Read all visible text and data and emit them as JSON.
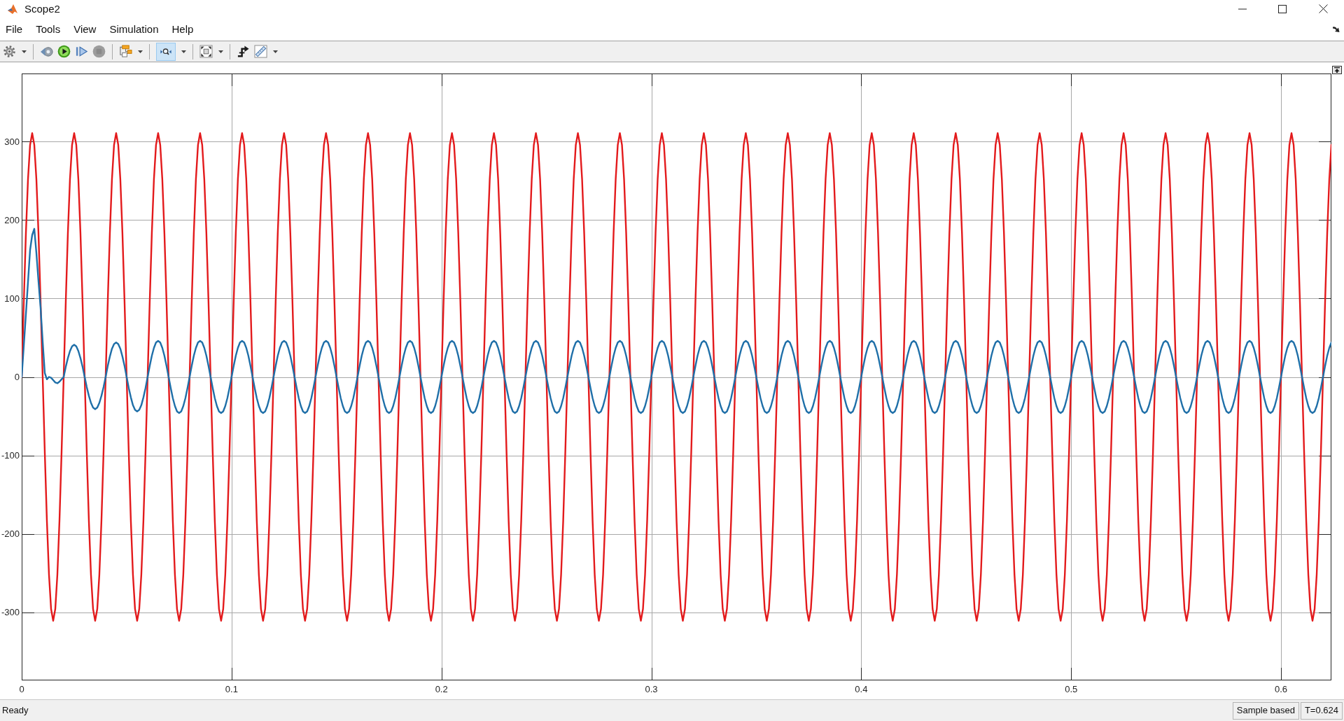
{
  "window": {
    "title": "Scope2"
  },
  "menu": [
    "File",
    "Tools",
    "View",
    "Simulation",
    "Help"
  ],
  "toolbar": [
    {
      "buttons": [
        {
          "kind": "settings",
          "dropdown": true,
          "on": false,
          "disabled": false
        }
      ]
    },
    {
      "buttons": [
        {
          "kind": "step_back",
          "dropdown": false,
          "on": false,
          "disabled": false
        },
        {
          "kind": "run",
          "dropdown": false,
          "on": false,
          "disabled": false
        },
        {
          "kind": "step_forward",
          "dropdown": false,
          "on": false,
          "disabled": false
        },
        {
          "kind": "stop",
          "dropdown": false,
          "on": false,
          "disabled": true
        }
      ]
    },
    {
      "buttons": [
        {
          "kind": "highlight",
          "dropdown": true,
          "on": false,
          "disabled": false
        }
      ]
    },
    {
      "buttons": [
        {
          "kind": "zoom",
          "dropdown": true,
          "on": true,
          "disabled": false
        }
      ]
    },
    {
      "buttons": [
        {
          "kind": "fit",
          "dropdown": true,
          "on": false,
          "disabled": false
        }
      ]
    },
    {
      "buttons": [
        {
          "kind": "trigger",
          "dropdown": false,
          "on": false,
          "disabled": false
        },
        {
          "kind": "measure",
          "dropdown": true,
          "on": false,
          "disabled": false
        }
      ]
    }
  ],
  "scope": {
    "chart_data": [
      {
        "type": "line",
        "xlim": [
          0,
          0.624
        ],
        "ylim": [
          -387,
          387
        ],
        "xticks": [
          0,
          0.1,
          0.2,
          0.3,
          0.4,
          0.5,
          0.6
        ],
        "yticks": [
          -300,
          -200,
          -100,
          0,
          100,
          200,
          300
        ],
        "grid": true,
        "x": [
          0.0,
          0.001,
          0.002,
          0.003,
          0.004,
          0.005,
          0.006,
          0.007,
          0.008,
          0.009,
          0.01,
          0.011,
          0.012,
          0.013,
          0.014,
          0.015,
          0.016,
          0.017,
          0.018,
          0.019,
          0.02,
          0.021,
          0.022,
          0.023,
          0.024,
          0.025,
          0.026,
          0.027,
          0.028,
          0.029,
          0.03,
          0.031,
          0.032,
          0.033,
          0.034,
          0.035,
          0.036,
          0.037,
          0.038,
          0.039,
          0.04,
          0.041,
          0.042,
          0.043,
          0.044,
          0.045,
          0.046,
          0.047,
          0.048,
          0.049,
          0.05,
          0.051,
          0.052,
          0.053,
          0.054,
          0.055,
          0.056,
          0.057,
          0.058,
          0.059,
          0.06,
          0.061,
          0.062,
          0.063,
          0.064,
          0.065,
          0.066,
          0.067,
          0.068,
          0.069,
          0.07,
          0.071,
          0.072,
          0.073,
          0.074,
          0.075,
          0.076,
          0.077,
          0.078,
          0.079,
          0.08,
          0.081,
          0.082,
          0.083,
          0.084,
          0.085,
          0.086,
          0.087,
          0.088,
          0.089,
          0.09,
          0.091,
          0.092,
          0.093,
          0.094,
          0.095,
          0.096,
          0.097,
          0.098,
          0.099,
          0.1,
          0.101,
          0.102,
          0.103,
          0.104,
          0.105,
          0.106,
          0.107,
          0.108,
          0.109,
          0.11,
          0.111,
          0.112,
          0.113,
          0.114,
          0.115,
          0.116,
          0.117,
          0.118,
          0.119,
          0.12,
          0.121,
          0.122,
          0.123,
          0.124,
          0.125,
          0.126,
          0.127,
          0.128,
          0.129,
          0.13,
          0.131,
          0.132,
          0.133,
          0.134,
          0.135,
          0.136,
          0.137,
          0.138,
          0.139,
          0.14,
          0.141,
          0.142,
          0.143,
          0.144,
          0.145,
          0.146,
          0.147,
          0.148,
          0.149,
          0.15,
          0.151,
          0.152,
          0.153,
          0.154,
          0.155,
          0.156,
          0.157,
          0.158,
          0.159,
          0.16,
          0.161,
          0.162,
          0.163,
          0.164,
          0.165,
          0.166,
          0.167,
          0.168,
          0.169,
          0.17,
          0.171,
          0.172,
          0.173,
          0.174,
          0.175,
          0.176,
          0.177,
          0.178,
          0.179,
          0.18,
          0.181,
          0.182,
          0.183,
          0.184,
          0.185,
          0.186,
          0.187,
          0.188,
          0.189,
          0.19,
          0.191,
          0.192,
          0.193,
          0.194,
          0.195,
          0.196,
          0.197,
          0.198,
          0.199,
          0.2,
          0.201,
          0.202,
          0.203,
          0.204,
          0.205,
          0.206,
          0.207,
          0.208,
          0.209,
          0.21,
          0.211,
          0.212,
          0.213,
          0.214,
          0.215,
          0.216,
          0.217,
          0.218,
          0.219,
          0.22,
          0.221,
          0.222,
          0.223,
          0.224,
          0.225,
          0.226,
          0.227,
          0.228,
          0.229,
          0.23,
          0.231,
          0.232,
          0.233,
          0.234,
          0.235,
          0.236,
          0.237,
          0.238,
          0.239,
          0.24,
          0.241,
          0.242,
          0.243,
          0.244,
          0.245,
          0.246,
          0.247,
          0.248,
          0.249,
          0.25,
          0.251,
          0.252,
          0.253,
          0.254,
          0.255,
          0.256,
          0.257,
          0.258,
          0.259,
          0.26,
          0.261,
          0.262,
          0.263,
          0.264,
          0.265,
          0.266,
          0.267,
          0.268,
          0.269,
          0.27,
          0.271,
          0.272,
          0.273,
          0.274,
          0.275,
          0.276,
          0.277,
          0.278,
          0.279,
          0.28,
          0.281,
          0.282,
          0.283,
          0.284,
          0.285,
          0.286,
          0.287,
          0.288,
          0.289,
          0.29,
          0.291,
          0.292,
          0.293,
          0.294,
          0.295,
          0.296,
          0.297,
          0.298,
          0.299,
          0.3,
          0.301,
          0.302,
          0.303,
          0.304,
          0.305,
          0.306,
          0.307,
          0.308,
          0.309,
          0.31,
          0.311,
          0.312,
          0.313,
          0.314,
          0.315,
          0.316,
          0.317,
          0.318,
          0.319,
          0.32,
          0.321,
          0.322,
          0.323,
          0.324,
          0.325,
          0.326,
          0.327,
          0.328,
          0.329,
          0.33,
          0.331,
          0.332,
          0.333,
          0.334,
          0.335,
          0.336,
          0.337,
          0.338,
          0.339,
          0.34,
          0.341,
          0.342,
          0.343,
          0.344,
          0.345,
          0.346,
          0.347,
          0.348,
          0.349,
          0.35,
          0.351,
          0.352,
          0.353,
          0.354,
          0.355,
          0.356,
          0.357,
          0.358,
          0.359,
          0.36,
          0.361,
          0.362,
          0.363,
          0.364,
          0.365,
          0.366,
          0.367,
          0.368,
          0.369,
          0.37,
          0.371,
          0.372,
          0.373,
          0.374,
          0.375,
          0.376,
          0.377,
          0.378,
          0.379,
          0.38,
          0.381,
          0.382,
          0.383,
          0.384,
          0.385,
          0.386,
          0.387,
          0.388,
          0.389,
          0.39,
          0.391,
          0.392,
          0.393,
          0.394,
          0.395,
          0.396,
          0.397,
          0.398,
          0.399,
          0.4,
          0.401,
          0.402,
          0.403,
          0.404,
          0.405,
          0.406,
          0.407,
          0.408,
          0.409,
          0.41,
          0.411,
          0.412,
          0.413,
          0.414,
          0.415,
          0.416,
          0.417,
          0.418,
          0.419,
          0.42,
          0.421,
          0.422,
          0.423,
          0.424,
          0.425,
          0.426,
          0.427,
          0.428,
          0.429,
          0.43,
          0.431,
          0.432,
          0.433,
          0.434,
          0.435,
          0.436,
          0.437,
          0.438,
          0.439,
          0.44,
          0.441,
          0.442,
          0.443,
          0.444,
          0.445,
          0.446,
          0.447,
          0.448,
          0.449,
          0.45,
          0.451,
          0.452,
          0.453,
          0.454,
          0.455,
          0.456,
          0.457,
          0.458,
          0.459,
          0.46,
          0.461,
          0.462,
          0.463,
          0.464,
          0.465,
          0.466,
          0.467,
          0.468,
          0.469,
          0.47,
          0.471,
          0.472,
          0.473,
          0.474,
          0.475,
          0.476,
          0.477,
          0.478,
          0.479,
          0.48,
          0.481,
          0.482,
          0.483,
          0.484,
          0.485,
          0.486,
          0.487,
          0.488,
          0.489,
          0.49,
          0.491,
          0.492,
          0.493,
          0.494,
          0.495,
          0.496,
          0.497,
          0.498,
          0.499,
          0.5,
          0.501,
          0.502,
          0.503,
          0.504,
          0.505,
          0.506,
          0.507,
          0.508,
          0.509,
          0.51,
          0.511,
          0.512,
          0.513,
          0.514,
          0.515,
          0.516,
          0.517,
          0.518,
          0.519,
          0.52,
          0.521,
          0.522,
          0.523,
          0.524,
          0.525,
          0.526,
          0.527,
          0.528,
          0.529,
          0.53,
          0.531,
          0.532,
          0.533,
          0.534,
          0.535,
          0.536,
          0.537,
          0.538,
          0.539,
          0.54,
          0.541,
          0.542,
          0.543,
          0.544,
          0.545,
          0.546,
          0.547,
          0.548,
          0.549,
          0.55,
          0.551,
          0.552,
          0.553,
          0.554,
          0.555,
          0.556,
          0.557,
          0.558,
          0.559,
          0.56,
          0.561,
          0.562,
          0.563,
          0.564,
          0.565,
          0.566,
          0.567,
          0.568,
          0.569,
          0.57,
          0.571,
          0.572,
          0.573,
          0.574,
          0.575,
          0.576,
          0.577,
          0.578,
          0.579,
          0.58,
          0.581,
          0.582,
          0.583,
          0.584,
          0.585,
          0.586,
          0.587,
          0.588,
          0.589,
          0.59,
          0.591,
          0.592,
          0.593,
          0.594,
          0.595,
          0.596,
          0.597,
          0.598,
          0.599,
          0.6,
          0.601,
          0.602,
          0.603,
          0.604,
          0.605,
          0.606,
          0.607,
          0.608,
          0.609,
          0.61,
          0.611,
          0.612,
          0.613,
          0.614,
          0.615,
          0.616,
          0.617,
          0.618,
          0.619,
          0.62,
          0.621,
          0.622,
          0.623,
          0.624
        ],
        "series": [
          {
            "color": "#e31a1c",
            "values": [
              0,
              96,
              183,
              252,
              296,
              311,
              296,
              252,
              183,
              96,
              0,
              -96,
              -183,
              -252,
              -296,
              -311,
              -296,
              -252,
              -183,
              -96,
              0,
              96,
              183,
              252,
              296,
              311,
              296,
              252,
              183,
              96,
              0,
              -96,
              -183,
              -252,
              -296,
              -311,
              -296,
              -252,
              -183,
              -96,
              0,
              96,
              183,
              252,
              296,
              311,
              296,
              252,
              183,
              96,
              0,
              -96,
              -183,
              -252,
              -296,
              -311,
              -296,
              -252,
              -183,
              -96,
              0,
              96,
              183,
              252,
              296,
              311,
              296,
              252,
              183,
              96,
              0,
              -96,
              -183,
              -252,
              -296,
              -311,
              -296,
              -252,
              -183,
              -96,
              0,
              96,
              183,
              252,
              296,
              311,
              296,
              252,
              183,
              96,
              0,
              -96,
              -183,
              -252,
              -296,
              -311,
              -296,
              -252,
              -183,
              -96,
              0,
              96,
              183,
              252,
              296,
              311,
              296,
              252,
              183,
              96,
              0,
              -96,
              -183,
              -252,
              -296,
              -311,
              -296,
              -252,
              -183,
              -96,
              0,
              96,
              183,
              252,
              296,
              311,
              296,
              252,
              183,
              96,
              0,
              -96,
              -183,
              -252,
              -296,
              -311,
              -296,
              -252,
              -183,
              -96,
              0,
              96,
              183,
              252,
              296,
              311,
              296,
              252,
              183,
              96,
              0,
              -96,
              -183,
              -252,
              -296,
              -311,
              -296,
              -252,
              -183,
              -96,
              0,
              96,
              183,
              252,
              296,
              311,
              296,
              252,
              183,
              96,
              0,
              -96,
              -183,
              -252,
              -296,
              -311,
              -296,
              -252,
              -183,
              -96,
              0,
              96,
              183,
              252,
              296,
              311,
              296,
              252,
              183,
              96,
              0,
              -96,
              -183,
              -252,
              -296,
              -311,
              -296,
              -252,
              -183,
              -96,
              0,
              96,
              183,
              252,
              296,
              311,
              296,
              252,
              183,
              96,
              0,
              -96,
              -183,
              -252,
              -296,
              -311,
              -296,
              -252,
              -183,
              -96,
              0,
              96,
              183,
              252,
              296,
              311,
              296,
              252,
              183,
              96,
              0,
              -96,
              -183,
              -252,
              -296,
              -311,
              -296,
              -252,
              -183,
              -96,
              0,
              96,
              183,
              252,
              296,
              311,
              296,
              252,
              183,
              96,
              0,
              -96,
              -183,
              -252,
              -296,
              -311,
              -296,
              -252,
              -183,
              -96,
              0,
              96,
              183,
              252,
              296,
              311,
              296,
              252,
              183,
              96,
              0,
              -96,
              -183,
              -252,
              -296,
              -311,
              -296,
              -252,
              -183,
              -96,
              0,
              96,
              183,
              252,
              296,
              311,
              296,
              252,
              183,
              96,
              0,
              -96,
              -183,
              -252,
              -296,
              -311,
              -296,
              -252,
              -183,
              -96,
              0,
              96,
              183,
              252,
              296,
              311,
              296,
              252,
              183,
              96,
              0,
              -96,
              -183,
              -252,
              -296,
              -311,
              -296,
              -252,
              -183,
              -96,
              0,
              96,
              183,
              252,
              296,
              311,
              296,
              252,
              183,
              96,
              0,
              -96,
              -183,
              -252,
              -296,
              -311,
              -296,
              -252,
              -183,
              -96,
              0,
              96,
              183,
              252,
              296,
              311,
              296,
              252,
              183,
              96,
              0,
              -96,
              -183,
              -252,
              -296,
              -311,
              -296,
              -252,
              -183,
              -96,
              0,
              96,
              183,
              252,
              296,
              311,
              296,
              252,
              183,
              96,
              0,
              -96,
              -183,
              -252,
              -296,
              -311,
              -296,
              -252,
              -183,
              -96,
              0,
              96,
              183,
              252,
              296,
              311,
              296,
              252,
              183,
              96,
              0,
              -96,
              -183,
              -252,
              -296,
              -311,
              -296,
              -252,
              -183,
              -96,
              0,
              96,
              183,
              252,
              296,
              311,
              296,
              252,
              183,
              96,
              0,
              -96,
              -183,
              -252,
              -296,
              -311,
              -296,
              -252,
              -183,
              -96,
              0,
              96,
              183,
              252,
              296,
              311,
              296,
              252,
              183,
              96,
              0,
              -96,
              -183,
              -252,
              -296,
              -311,
              -296,
              -252,
              -183,
              -96,
              0,
              96,
              183,
              252,
              296,
              311,
              296,
              252,
              183,
              96,
              0,
              -96,
              -183,
              -252,
              -296,
              -311,
              -296,
              -252,
              -183,
              -96,
              0,
              96,
              183,
              252,
              296,
              311,
              296,
              252,
              183,
              96,
              0,
              -96,
              -183,
              -252,
              -296,
              -311,
              -296,
              -252,
              -183,
              -96,
              0,
              96,
              183,
              252,
              296,
              311,
              296,
              252,
              183,
              96,
              0,
              -96,
              -183,
              -252,
              -296,
              -311,
              -296,
              -252,
              -183,
              -96,
              0,
              96,
              183,
              252,
              296,
              311,
              296,
              252,
              183,
              96,
              0,
              -96,
              -183,
              -252,
              -296,
              -311,
              -296,
              -252,
              -183,
              -96,
              0,
              96,
              183,
              252,
              296,
              311,
              296,
              252,
              183,
              96,
              0,
              -96,
              -183,
              -252,
              -296,
              -311,
              -296,
              -252,
              -183,
              -96,
              0,
              96,
              183,
              252,
              296,
              311,
              296,
              252,
              183,
              96,
              0,
              -96,
              -183,
              -252,
              -296,
              -311,
              -296,
              -252,
              -183,
              -96,
              0,
              96,
              183,
              252,
              296,
              311,
              296,
              252,
              183,
              96,
              0,
              -96,
              -183,
              -252,
              -296,
              -311,
              -296,
              -252,
              -183,
              -96,
              0,
              96,
              183,
              252,
              296,
              311,
              296,
              252,
              183,
              96,
              0,
              -96,
              -183,
              -252,
              -296,
              -311,
              -296,
              -252,
              -183,
              -96,
              0,
              96,
              183,
              252,
              296,
              311,
              296,
              252,
              183,
              96,
              0,
              -96,
              -183,
              -252,
              -296,
              -311,
              -296,
              -252,
              -183,
              -96,
              0,
              96,
              183,
              252,
              296
            ]
          },
          {
            "color": "#1f6fa8",
            "values": [
              0,
              40,
              80,
              121,
              162,
              181,
              189,
              158,
              122,
              88,
              45,
              5,
              -3,
              0,
              -1,
              -4,
              -7,
              -8,
              -6,
              -3,
              0,
              13,
              24,
              33,
              39,
              41,
              39,
              33,
              24,
              13,
              0,
              -13,
              -24,
              -33,
              -39,
              -41,
              -39,
              -33,
              -24,
              -13,
              0,
              14,
              26,
              36,
              42,
              44,
              42,
              36,
              26,
              14,
              0,
              -14,
              -26,
              -36,
              -42,
              -44,
              -42,
              -36,
              -26,
              -14,
              0,
              14,
              27,
              37,
              44,
              46,
              44,
              37,
              27,
              14,
              0,
              -14,
              -27,
              -37,
              -44,
              -46,
              -44,
              -37,
              -27,
              -14,
              0,
              14,
              27,
              37,
              44,
              46,
              44,
              37,
              27,
              14,
              0,
              -14,
              -27,
              -37,
              -44,
              -46,
              -44,
              -37,
              -27,
              -14,
              0,
              14,
              27,
              37,
              44,
              46,
              44,
              37,
              27,
              14,
              0,
              -14,
              -27,
              -37,
              -44,
              -46,
              -44,
              -37,
              -27,
              -14,
              0,
              14,
              27,
              37,
              44,
              46,
              44,
              37,
              27,
              14,
              0,
              -14,
              -27,
              -37,
              -44,
              -46,
              -44,
              -37,
              -27,
              -14,
              0,
              14,
              27,
              37,
              44,
              46,
              44,
              37,
              27,
              14,
              0,
              -14,
              -27,
              -37,
              -44,
              -46,
              -44,
              -37,
              -27,
              -14,
              0,
              14,
              27,
              37,
              44,
              46,
              44,
              37,
              27,
              14,
              0,
              -14,
              -27,
              -37,
              -44,
              -46,
              -44,
              -37,
              -27,
              -14,
              0,
              14,
              27,
              37,
              44,
              46,
              44,
              37,
              27,
              14,
              0,
              -14,
              -27,
              -37,
              -44,
              -46,
              -44,
              -37,
              -27,
              -14,
              0,
              14,
              27,
              37,
              44,
              46,
              44,
              37,
              27,
              14,
              0,
              -14,
              -27,
              -37,
              -44,
              -46,
              -44,
              -37,
              -27,
              -14,
              0,
              14,
              27,
              37,
              44,
              46,
              44,
              37,
              27,
              14,
              0,
              -14,
              -27,
              -37,
              -44,
              -46,
              -44,
              -37,
              -27,
              -14,
              0,
              14,
              27,
              37,
              44,
              46,
              44,
              37,
              27,
              14,
              0,
              -14,
              -27,
              -37,
              -44,
              -46,
              -44,
              -37,
              -27,
              -14,
              0,
              14,
              27,
              37,
              44,
              46,
              44,
              37,
              27,
              14,
              0,
              -14,
              -27,
              -37,
              -44,
              -46,
              -44,
              -37,
              -27,
              -14,
              0,
              14,
              27,
              37,
              44,
              46,
              44,
              37,
              27,
              14,
              0,
              -14,
              -27,
              -37,
              -44,
              -46,
              -44,
              -37,
              -27,
              -14,
              0,
              14,
              27,
              37,
              44,
              46,
              44,
              37,
              27,
              14,
              0,
              -14,
              -27,
              -37,
              -44,
              -46,
              -44,
              -37,
              -27,
              -14,
              0,
              14,
              27,
              37,
              44,
              46,
              44,
              37,
              27,
              14,
              0,
              -14,
              -27,
              -37,
              -44,
              -46,
              -44,
              -37,
              -27,
              -14,
              0,
              14,
              27,
              37,
              44,
              46,
              44,
              37,
              27,
              14,
              0,
              -14,
              -27,
              -37,
              -44,
              -46,
              -44,
              -37,
              -27,
              -14,
              0,
              14,
              27,
              37,
              44,
              46,
              44,
              37,
              27,
              14,
              0,
              -14,
              -27,
              -37,
              -44,
              -46,
              -44,
              -37,
              -27,
              -14,
              0,
              14,
              27,
              37,
              44,
              46,
              44,
              37,
              27,
              14,
              0,
              -14,
              -27,
              -37,
              -44,
              -46,
              -44,
              -37,
              -27,
              -14,
              0,
              14,
              27,
              37,
              44,
              46,
              44,
              37,
              27,
              14,
              0,
              -14,
              -27,
              -37,
              -44,
              -46,
              -44,
              -37,
              -27,
              -14,
              0,
              14,
              27,
              37,
              44,
              46,
              44,
              37,
              27,
              14,
              0,
              -14,
              -27,
              -37,
              -44,
              -46,
              -44,
              -37,
              -27,
              -14,
              0,
              14,
              27,
              37,
              44,
              46,
              44,
              37,
              27,
              14,
              0,
              -14,
              -27,
              -37,
              -44,
              -46,
              -44,
              -37,
              -27,
              -14,
              0,
              14,
              27,
              37,
              44,
              46,
              44,
              37,
              27,
              14,
              0,
              -14,
              -27,
              -37,
              -44,
              -46,
              -44,
              -37,
              -27,
              -14,
              0,
              14,
              27,
              37,
              44,
              46,
              44,
              37,
              27,
              14,
              0,
              -14,
              -27,
              -37,
              -44,
              -46,
              -44,
              -37,
              -27,
              -14,
              0,
              14,
              27,
              37,
              44,
              46,
              44,
              37,
              27,
              14,
              0,
              -14,
              -27,
              -37,
              -44,
              -46,
              -44,
              -37,
              -27,
              -14,
              0,
              14,
              27,
              37,
              44,
              46,
              44,
              37,
              27,
              14,
              0,
              -14,
              -27,
              -37,
              -44,
              -46,
              -44,
              -37,
              -27,
              -14,
              0,
              14,
              27,
              37,
              44,
              46,
              44,
              37,
              27,
              14,
              0,
              -14,
              -27,
              -37,
              -44,
              -46,
              -44,
              -37,
              -27,
              -14,
              0,
              14,
              27,
              37,
              44,
              46,
              44,
              37,
              27,
              14,
              0,
              -14,
              -27,
              -37,
              -44,
              -46,
              -44,
              -37,
              -27,
              -14,
              0,
              14,
              27,
              37,
              44,
              46,
              44,
              37,
              27,
              14,
              0,
              -14,
              -27,
              -37,
              -44,
              -46,
              -44,
              -37,
              -27,
              -14,
              0,
              14,
              27,
              37,
              44,
              46,
              44,
              37,
              27,
              14,
              0,
              -14,
              -27,
              -37,
              -44,
              -46,
              -44,
              -37,
              -27,
              -14,
              0,
              14,
              27,
              37,
              44
            ]
          }
        ]
      }
    ]
  },
  "status_bar": {
    "message": "Ready",
    "fields": [
      "Sample based",
      "T=0.624"
    ]
  }
}
